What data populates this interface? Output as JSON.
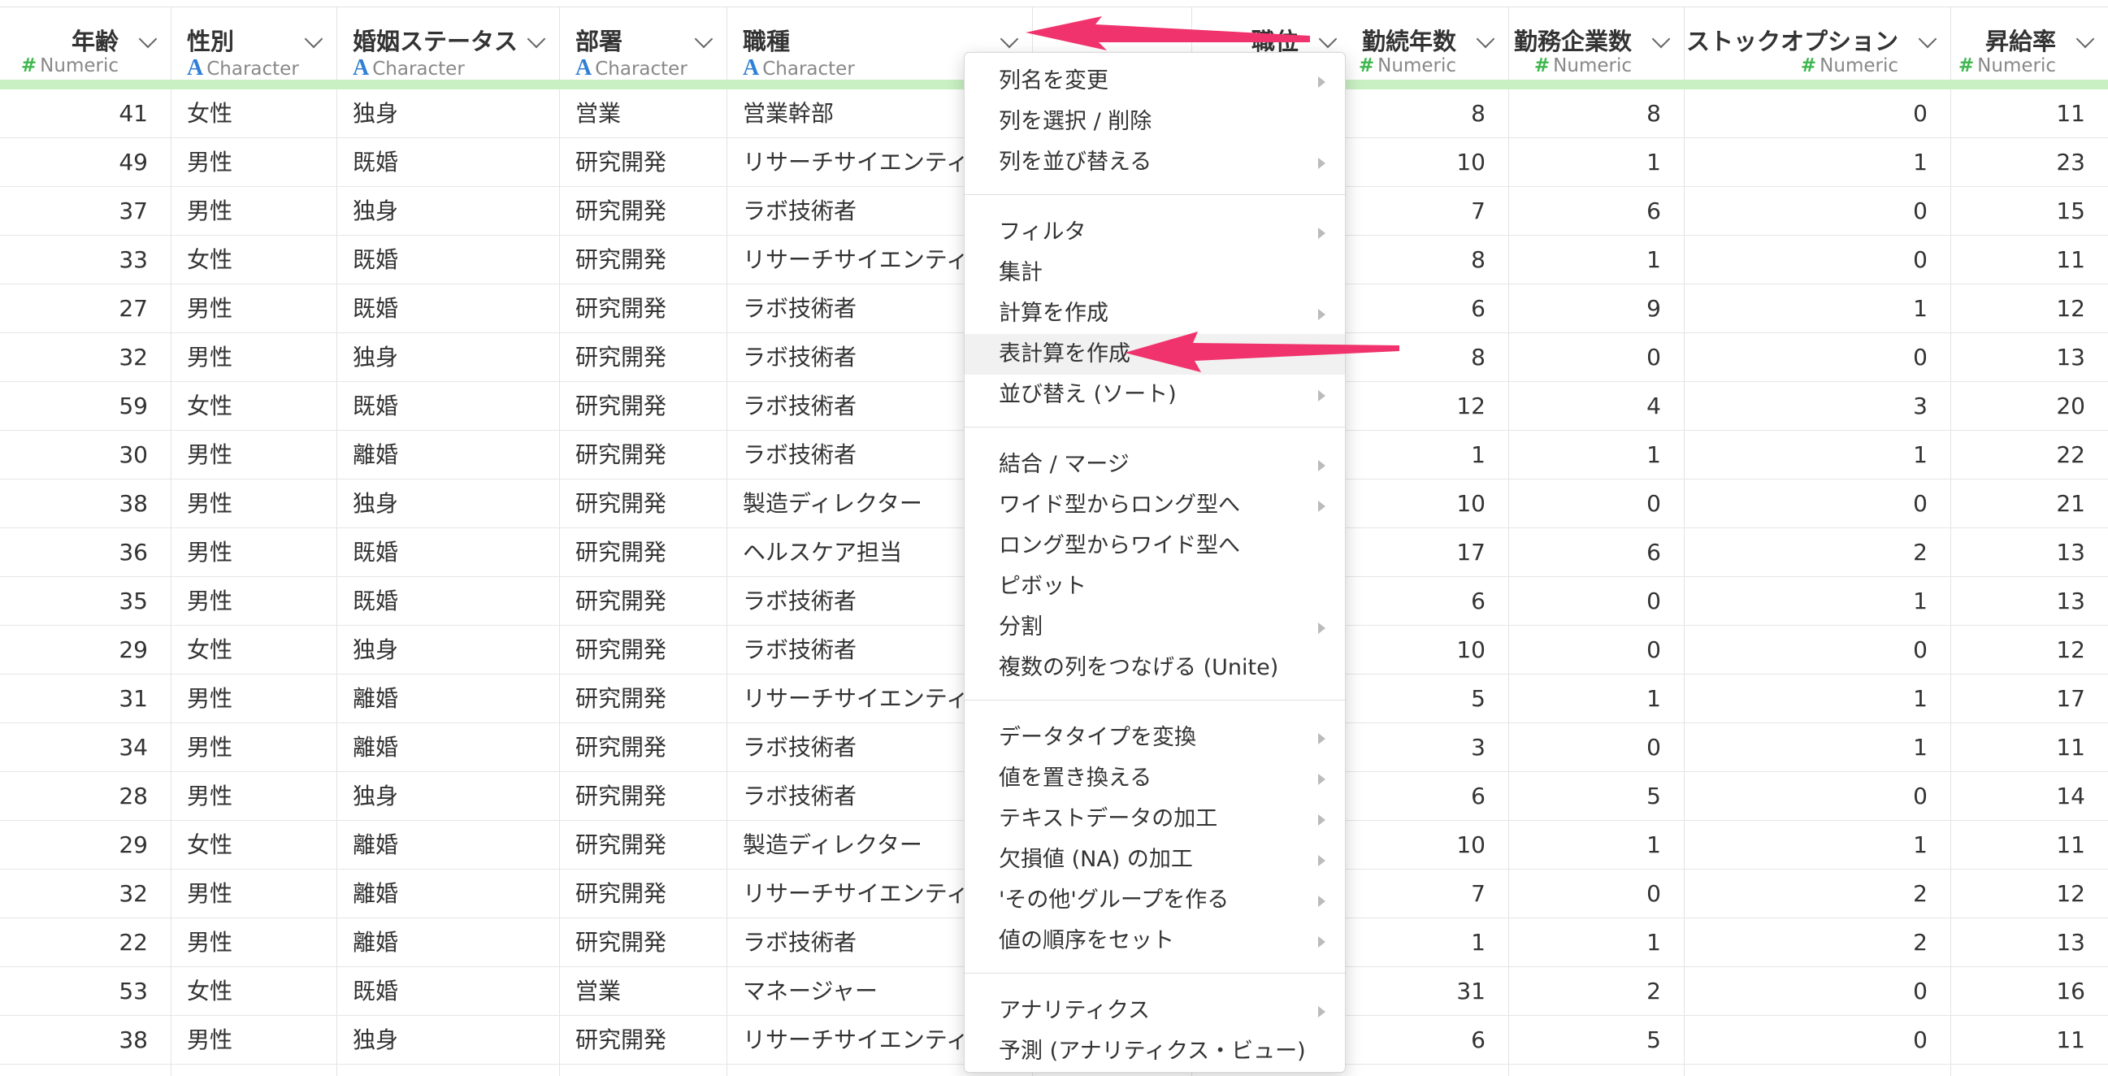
{
  "columns": [
    {
      "name": "年齢",
      "type": "Numeric",
      "type_icon": "#"
    },
    {
      "name": "性別",
      "type": "Character",
      "type_icon": "A"
    },
    {
      "name": "婚姻ステータス",
      "type": "Character",
      "type_icon": "A"
    },
    {
      "name": "部署",
      "type": "Character",
      "type_icon": "A"
    },
    {
      "name": "職種",
      "type": "Character",
      "type_icon": "A"
    },
    {
      "name": "職位",
      "type": "",
      "type_icon": ""
    },
    {
      "name": "勤続年数",
      "type": "Numeric",
      "type_icon": "#"
    },
    {
      "name": "勤務企業数",
      "type": "Numeric",
      "type_icon": "#"
    },
    {
      "name": "ストックオプション",
      "type": "Numeric",
      "type_icon": "#"
    },
    {
      "name": "昇給率",
      "type": "Numeric",
      "type_icon": "#"
    }
  ],
  "rows": [
    [
      "41",
      "女性",
      "独身",
      "営業",
      "営業幹部",
      "8",
      "8",
      "0",
      "11"
    ],
    [
      "49",
      "男性",
      "既婚",
      "研究開発",
      "リサーチサイエンティ",
      "10",
      "1",
      "1",
      "23"
    ],
    [
      "37",
      "男性",
      "独身",
      "研究開発",
      "ラボ技術者",
      "7",
      "6",
      "0",
      "15"
    ],
    [
      "33",
      "女性",
      "既婚",
      "研究開発",
      "リサーチサイエンティ",
      "8",
      "1",
      "0",
      "11"
    ],
    [
      "27",
      "男性",
      "既婚",
      "研究開発",
      "ラボ技術者",
      "6",
      "9",
      "1",
      "12"
    ],
    [
      "32",
      "男性",
      "独身",
      "研究開発",
      "ラボ技術者",
      "8",
      "0",
      "0",
      "13"
    ],
    [
      "59",
      "女性",
      "既婚",
      "研究開発",
      "ラボ技術者",
      "12",
      "4",
      "3",
      "20"
    ],
    [
      "30",
      "男性",
      "離婚",
      "研究開発",
      "ラボ技術者",
      "1",
      "1",
      "1",
      "22"
    ],
    [
      "38",
      "男性",
      "独身",
      "研究開発",
      "製造ディレクター",
      "10",
      "0",
      "0",
      "21"
    ],
    [
      "36",
      "男性",
      "既婚",
      "研究開発",
      "ヘルスケア担当",
      "17",
      "6",
      "2",
      "13"
    ],
    [
      "35",
      "男性",
      "既婚",
      "研究開発",
      "ラボ技術者",
      "6",
      "0",
      "1",
      "13"
    ],
    [
      "29",
      "女性",
      "独身",
      "研究開発",
      "ラボ技術者",
      "10",
      "0",
      "0",
      "12"
    ],
    [
      "31",
      "男性",
      "離婚",
      "研究開発",
      "リサーチサイエンティ",
      "5",
      "1",
      "1",
      "17"
    ],
    [
      "34",
      "男性",
      "離婚",
      "研究開発",
      "ラボ技術者",
      "3",
      "0",
      "1",
      "11"
    ],
    [
      "28",
      "男性",
      "独身",
      "研究開発",
      "ラボ技術者",
      "6",
      "5",
      "0",
      "14"
    ],
    [
      "29",
      "女性",
      "離婚",
      "研究開発",
      "製造ディレクター",
      "10",
      "1",
      "1",
      "11"
    ],
    [
      "32",
      "男性",
      "離婚",
      "研究開発",
      "リサーチサイエンティ",
      "7",
      "0",
      "2",
      "12"
    ],
    [
      "22",
      "男性",
      "離婚",
      "研究開発",
      "ラボ技術者",
      "1",
      "1",
      "2",
      "13"
    ],
    [
      "53",
      "女性",
      "既婚",
      "営業",
      "マネージャー",
      "31",
      "2",
      "0",
      "16"
    ],
    [
      "38",
      "男性",
      "独身",
      "研究開発",
      "リサーチサイエンティ",
      "6",
      "5",
      "0",
      "11"
    ]
  ],
  "menu_groups": [
    [
      {
        "label": "列名を変更",
        "submenu": true
      },
      {
        "label": "列を選択 / 削除",
        "submenu": false
      },
      {
        "label": "列を並び替える",
        "submenu": true
      }
    ],
    [
      {
        "label": "フィルタ",
        "submenu": true
      },
      {
        "label": "集計",
        "submenu": false
      },
      {
        "label": "計算を作成",
        "submenu": true
      },
      {
        "label": "表計算を作成",
        "submenu": false,
        "highlighted": true
      },
      {
        "label": "並び替え (ソート)",
        "submenu": true
      }
    ],
    [
      {
        "label": "結合 / マージ",
        "submenu": true
      },
      {
        "label": "ワイド型からロング型へ",
        "submenu": true
      },
      {
        "label": "ロング型からワイド型へ",
        "submenu": false
      },
      {
        "label": "ピボット",
        "submenu": false
      },
      {
        "label": "分割",
        "submenu": true
      },
      {
        "label": "複数の列をつなげる (Unite)",
        "submenu": false
      }
    ],
    [
      {
        "label": "データタイプを変換",
        "submenu": true
      },
      {
        "label": "値を置き換える",
        "submenu": true
      },
      {
        "label": "テキストデータの加工",
        "submenu": true
      },
      {
        "label": "欠損値 (NA) の加工",
        "submenu": true
      },
      {
        "label": "'その他'グループを作る",
        "submenu": true
      },
      {
        "label": "値の順序をセット",
        "submenu": true
      }
    ],
    [
      {
        "label": "アナリティクス",
        "submenu": true
      },
      {
        "label": "予測 (アナリティクス・ビュー)",
        "submenu": false
      }
    ]
  ],
  "colors": {
    "accent_arrow": "#f0336c",
    "numeric_icon": "#3fb74e",
    "character_icon": "#2f7fd6",
    "header_band": "#c8f0c2"
  }
}
